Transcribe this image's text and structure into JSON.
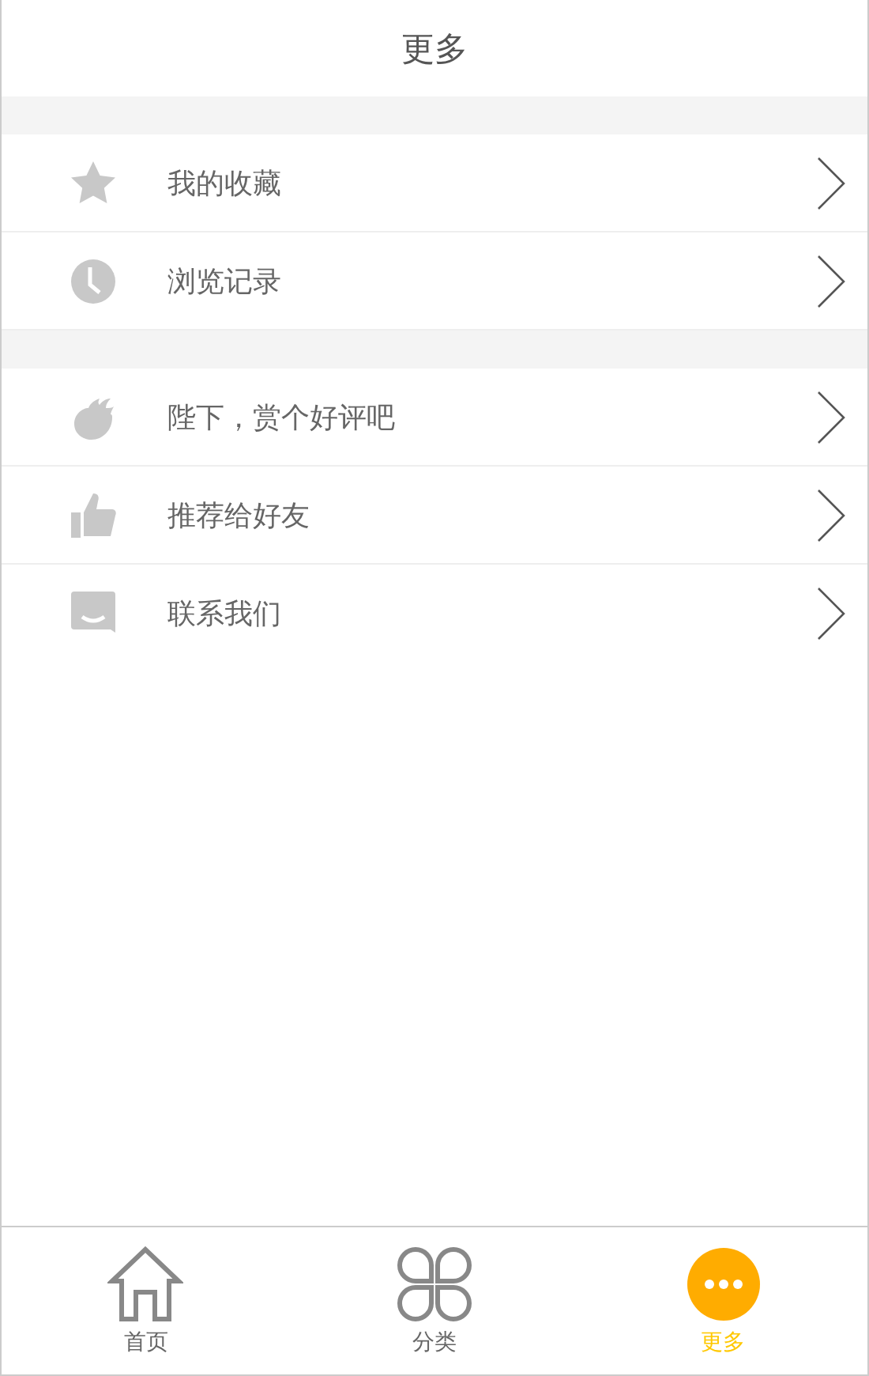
{
  "header": {
    "title": "更多"
  },
  "sections": [
    {
      "items": [
        {
          "kind": "star",
          "label": "我的收藏"
        },
        {
          "kind": "clock",
          "label": "浏览记录"
        }
      ]
    },
    {
      "items": [
        {
          "kind": "flame",
          "label": "陛下，赏个好评吧"
        },
        {
          "kind": "thumb",
          "label": "推荐给好友"
        },
        {
          "kind": "chat",
          "label": "联系我们"
        }
      ]
    }
  ],
  "tabs": [
    {
      "kind": "home",
      "label": "首页",
      "selected": false
    },
    {
      "kind": "category",
      "label": "分类",
      "selected": false
    },
    {
      "kind": "more",
      "label": "更多",
      "selected": true
    }
  ]
}
